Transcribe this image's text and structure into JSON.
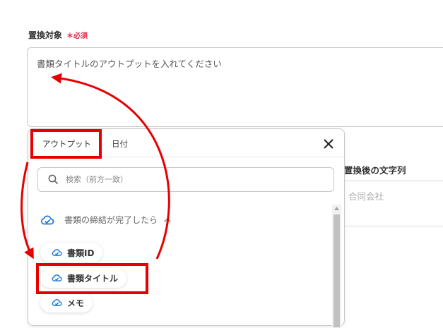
{
  "field": {
    "label": "置換対象",
    "required": "＊必須",
    "value": "書類タイトルのアウトプットを入れてください"
  },
  "right_panel": {
    "header": "置換後の文字列",
    "value": "合同会社"
  },
  "dropdown": {
    "tabs": [
      {
        "label": "アウトプット",
        "active": true
      },
      {
        "label": "日付",
        "active": false
      }
    ],
    "close_icon": "close-icon",
    "search_placeholder": "検索（前方一致）",
    "group": {
      "label": "書類の締結が完了したら",
      "icon": "cloud-sign-icon",
      "expanded": true
    },
    "items": [
      {
        "label": "書類ID"
      },
      {
        "label": "書類タイトル"
      },
      {
        "label": "メモ"
      }
    ]
  },
  "colors": {
    "annotation_red": "#e60000",
    "required_red": "#e0294a",
    "icon_blue": "#1f7ad6"
  }
}
